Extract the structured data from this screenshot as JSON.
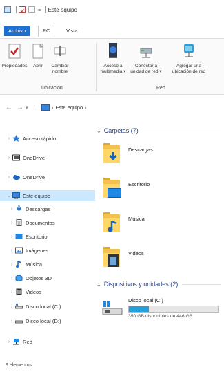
{
  "window": {
    "title": "Este equipo"
  },
  "ribbon": {
    "tabs": [
      {
        "label": "Archivo"
      },
      {
        "label": "PC"
      },
      {
        "label": "Vista"
      }
    ],
    "buttons": [
      {
        "label": "Propiedades"
      },
      {
        "label": "Abrir"
      },
      {
        "label": "Cambiar\nnombre"
      },
      {
        "label": "Acceso a\nmultimedia ▾"
      },
      {
        "label": "Conectar a\nunidad de red ▾"
      },
      {
        "label": "Agregar una\nubicación de red"
      }
    ],
    "groups": [
      {
        "label": "Ubicación"
      },
      {
        "label": "Red"
      }
    ]
  },
  "address": {
    "path": "Este equipo",
    "separator": "›"
  },
  "nav": [
    {
      "label": "Acceso rápido",
      "icon": "star-icon"
    },
    {
      "label": "OneDrive",
      "icon": "onedrive-icon"
    },
    {
      "label": "OneDrive",
      "icon": "cloud-icon"
    },
    {
      "label": "Este equipo",
      "icon": "computer-icon"
    },
    {
      "label": "Descargas",
      "icon": "download-icon"
    },
    {
      "label": "Documentos",
      "icon": "document-icon"
    },
    {
      "label": "Escritorio",
      "icon": "desktop-icon"
    },
    {
      "label": "Imágenes",
      "icon": "image-icon"
    },
    {
      "label": "Música",
      "icon": "music-icon"
    },
    {
      "label": "Objetos 3D",
      "icon": "cube-icon"
    },
    {
      "label": "Videos",
      "icon": "video-icon"
    },
    {
      "label": "Disco local (C:)",
      "icon": "disk-icon"
    },
    {
      "label": "Disco local (D:)",
      "icon": "disk-icon"
    },
    {
      "label": "Red",
      "icon": "network-icon"
    }
  ],
  "status": {
    "text": "9 elementos"
  },
  "main": {
    "folders_header": "Carpetas (7)",
    "folders": [
      {
        "label": "Descargas",
        "icon": "downloads-folder-icon"
      },
      {
        "label": "Escritorio",
        "icon": "desktop-folder-icon"
      },
      {
        "label": "Música",
        "icon": "music-folder-icon"
      },
      {
        "label": "Videos",
        "icon": "videos-folder-icon"
      }
    ],
    "devices_header": "Dispositivos y unidades (2)",
    "drive": {
      "label": "Disco local (C:)",
      "free_text": "350 GB disponibles de 446 GB",
      "used_fraction": 0.22
    }
  },
  "colors": {
    "accent": "#1d6fd1",
    "selection": "#cce8ff",
    "header_text": "#1e3f8a",
    "drive_fill": "#26a0da"
  }
}
